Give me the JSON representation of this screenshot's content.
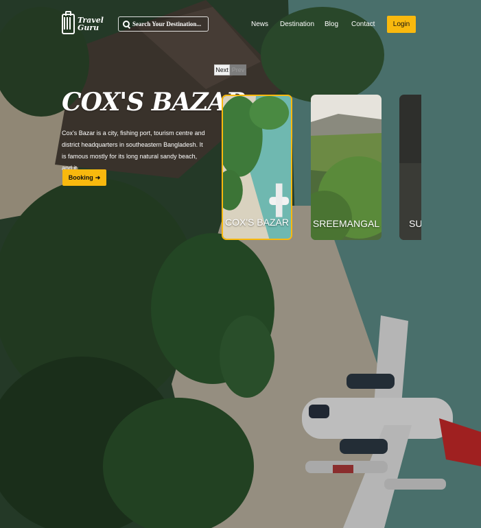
{
  "header": {
    "logo_line1": "Travel",
    "logo_line2": "Guru",
    "search_placeholder": "Search Your Destination...",
    "nav": [
      "News",
      "Destination",
      "Blog",
      "Contact"
    ],
    "login_label": "Login"
  },
  "hero": {
    "title": "COX'S BAZAR",
    "description": "Cox's Bazar is a city, fishing port, tourism centre and district headquarters in southeastern Bangladesh. It is famous mostly for its long natural sandy beach, and it...",
    "booking_label": "Booking"
  },
  "slider": {
    "next_label": "Next",
    "prev_label": "Prev"
  },
  "cards": [
    {
      "name": "COX'S BAZAR",
      "active": true
    },
    {
      "name": "SREEMANGAL",
      "active": false
    },
    {
      "name": "SU",
      "active": false
    }
  ],
  "colors": {
    "accent": "#f9b90e"
  }
}
